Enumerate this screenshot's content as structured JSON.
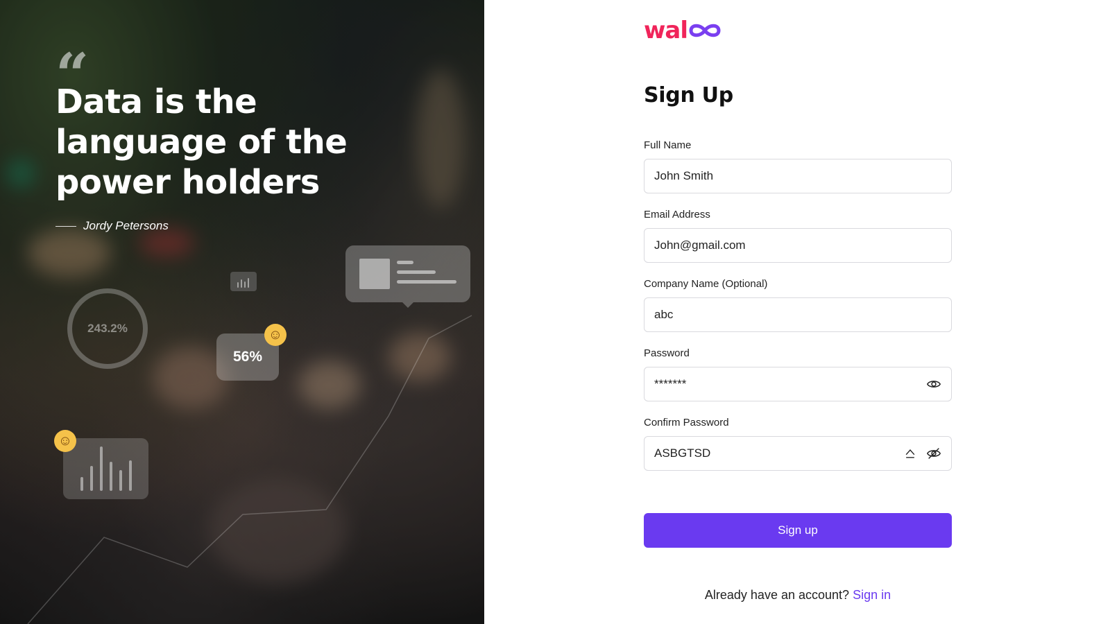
{
  "hero": {
    "quote": "Data is the language of the power holders",
    "author": "Jordy Petersons",
    "widgets": {
      "ring_value": "243.2%",
      "card_value": "56%"
    }
  },
  "brand": {
    "logo_text": "wal",
    "colors": {
      "brand_pink": "#f0245a",
      "accent": "#6a3af0"
    }
  },
  "form": {
    "title": "Sign Up",
    "fields": [
      {
        "label": "Full Name",
        "value": "John Smith"
      },
      {
        "label": "Email Address",
        "value": "John@gmail.com"
      },
      {
        "label": "Company Name (Optional)",
        "value": "abc"
      },
      {
        "label": "Password",
        "value": "*******",
        "icons": [
          "eye-icon"
        ]
      },
      {
        "label": "Confirm Password",
        "value": "ASBGTSD",
        "icons": [
          "caps-lock-icon",
          "eye-off-icon"
        ]
      }
    ],
    "submit_label": "Sign up",
    "footer_text": "Already have an account?",
    "footer_link": "Sign in"
  }
}
